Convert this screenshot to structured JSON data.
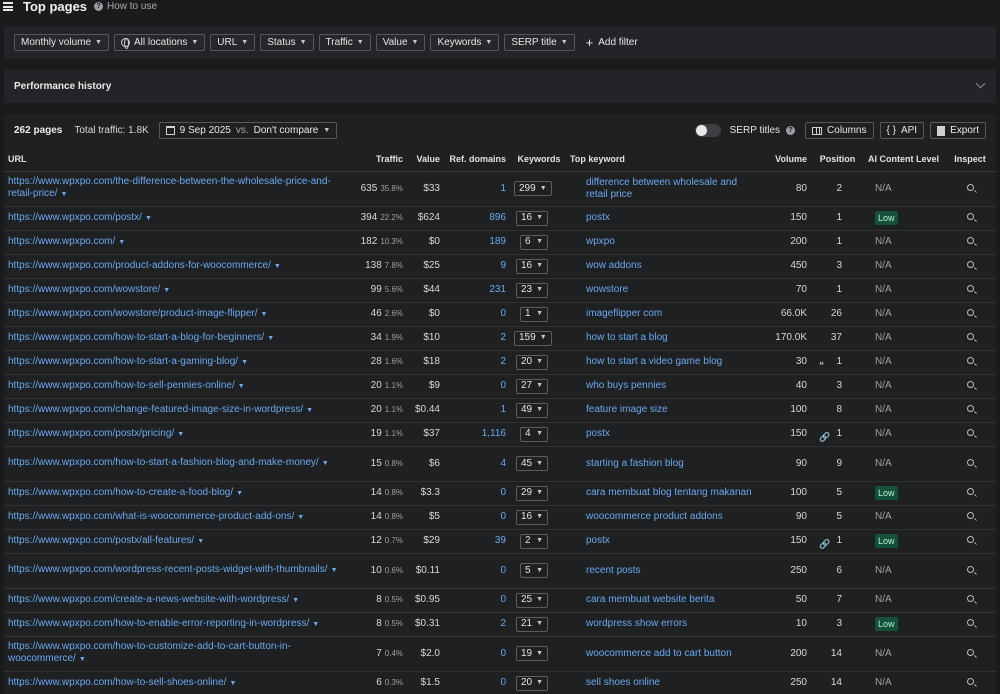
{
  "header": {
    "title": "Top pages",
    "howto": "How to use"
  },
  "filters": [
    {
      "label": "Monthly volume",
      "icon": ""
    },
    {
      "label": "All locations",
      "icon": "globe-icon"
    },
    {
      "label": "URL",
      "icon": ""
    },
    {
      "label": "Status",
      "icon": ""
    },
    {
      "label": "Traffic",
      "icon": ""
    },
    {
      "label": "Value",
      "icon": ""
    },
    {
      "label": "Keywords",
      "icon": ""
    },
    {
      "label": "SERP title",
      "icon": ""
    }
  ],
  "add_filter": "Add filter",
  "performance": {
    "title": "Performance history"
  },
  "toolbar": {
    "pages": "262 pages",
    "total_traffic": "Total traffic: 1.8K",
    "date": "9 Sep 2025",
    "vs": "vs.",
    "compare": "Don't compare",
    "serp_titles": "SERP titles",
    "columns": "Columns",
    "api": "API",
    "export": "Export"
  },
  "columns": [
    "URL",
    "Traffic",
    "Value",
    "Ref. domains",
    "Keywords",
    "Top keyword",
    "Volume",
    "Position",
    "AI Content Level",
    "Inspect"
  ],
  "rows": [
    {
      "url": "https://www.wpxpo.com/the-difference-between-the-wholesale-price-and-retail-price/",
      "traffic": "635",
      "pct": "35.8%",
      "value": "$33",
      "ref": "1",
      "kw": "299",
      "topkw": "difference between wholesale and retail price",
      "volume": "80",
      "pos": "2",
      "pos_icon": "",
      "ai": "N/A",
      "tall": true
    },
    {
      "url": "https://www.wpxpo.com/postx/",
      "traffic": "394",
      "pct": "22.2%",
      "value": "$624",
      "ref": "896",
      "kw": "16",
      "topkw": "postx",
      "volume": "150",
      "pos": "1",
      "pos_icon": "",
      "ai": "Low",
      "tall": false
    },
    {
      "url": "https://www.wpxpo.com/",
      "traffic": "182",
      "pct": "10.3%",
      "value": "$0",
      "ref": "189",
      "kw": "6",
      "topkw": "wpxpo",
      "volume": "200",
      "pos": "1",
      "pos_icon": "",
      "ai": "N/A",
      "tall": false
    },
    {
      "url": "https://www.wpxpo.com/product-addons-for-woocommerce/",
      "traffic": "138",
      "pct": "7.8%",
      "value": "$25",
      "ref": "9",
      "kw": "16",
      "topkw": "wow addons",
      "volume": "450",
      "pos": "3",
      "pos_icon": "",
      "ai": "N/A",
      "tall": false
    },
    {
      "url": "https://www.wpxpo.com/wowstore/",
      "traffic": "99",
      "pct": "5.6%",
      "value": "$44",
      "ref": "231",
      "kw": "23",
      "topkw": "wowstore",
      "volume": "70",
      "pos": "1",
      "pos_icon": "",
      "ai": "N/A",
      "tall": false
    },
    {
      "url": "https://www.wpxpo.com/wowstore/product-image-flipper/",
      "traffic": "46",
      "pct": "2.6%",
      "value": "$0",
      "ref": "0",
      "kw": "1",
      "topkw": "imageflipper com",
      "volume": "66.0K",
      "pos": "26",
      "pos_icon": "",
      "ai": "N/A",
      "tall": false
    },
    {
      "url": "https://www.wpxpo.com/how-to-start-a-blog-for-beginners/",
      "traffic": "34",
      "pct": "1.9%",
      "value": "$10",
      "ref": "2",
      "kw": "159",
      "topkw": "how to start a blog",
      "volume": "170.0K",
      "pos": "37",
      "pos_icon": "",
      "ai": "N/A",
      "tall": false
    },
    {
      "url": "https://www.wpxpo.com/how-to-start-a-gaming-blog/",
      "traffic": "28",
      "pct": "1.6%",
      "value": "$18",
      "ref": "2",
      "kw": "20",
      "topkw": "how to start a video game blog",
      "volume": "30",
      "pos": "1",
      "pos_icon": "❝",
      "ai": "N/A",
      "tall": false
    },
    {
      "url": "https://www.wpxpo.com/how-to-sell-pennies-online/",
      "traffic": "20",
      "pct": "1.1%",
      "value": "$9",
      "ref": "0",
      "kw": "27",
      "topkw": "who buys pennies",
      "volume": "40",
      "pos": "3",
      "pos_icon": "",
      "ai": "N/A",
      "tall": false
    },
    {
      "url": "https://www.wpxpo.com/change-featured-image-size-in-wordpress/",
      "traffic": "20",
      "pct": "1.1%",
      "value": "$0.44",
      "ref": "1",
      "kw": "49",
      "topkw": "feature image size",
      "volume": "100",
      "pos": "8",
      "pos_icon": "",
      "ai": "N/A",
      "tall": false
    },
    {
      "url": "https://www.wpxpo.com/postx/pricing/",
      "traffic": "19",
      "pct": "1.1%",
      "value": "$37",
      "ref": "1,116",
      "kw": "4",
      "topkw": "postx",
      "volume": "150",
      "pos": "1",
      "pos_icon": "🔗",
      "ai": "N/A",
      "tall": false
    },
    {
      "url": "https://www.wpxpo.com/how-to-start-a-fashion-blog-and-make-money/",
      "traffic": "15",
      "pct": "0.8%",
      "value": "$6",
      "ref": "4",
      "kw": "45",
      "topkw": "starting a fashion blog",
      "volume": "90",
      "pos": "9",
      "pos_icon": "",
      "ai": "N/A",
      "tall": true
    },
    {
      "url": "https://www.wpxpo.com/how-to-create-a-food-blog/",
      "traffic": "14",
      "pct": "0.8%",
      "value": "$3.3",
      "ref": "0",
      "kw": "29",
      "topkw": "cara membuat blog tentang makanan",
      "volume": "100",
      "pos": "5",
      "pos_icon": "",
      "ai": "Low",
      "tall": false
    },
    {
      "url": "https://www.wpxpo.com/what-is-woocommerce-product-add-ons/",
      "traffic": "14",
      "pct": "0.8%",
      "value": "$5",
      "ref": "0",
      "kw": "16",
      "topkw": "woocommerce product addons",
      "volume": "90",
      "pos": "5",
      "pos_icon": "",
      "ai": "N/A",
      "tall": false
    },
    {
      "url": "https://www.wpxpo.com/postx/all-features/",
      "traffic": "12",
      "pct": "0.7%",
      "value": "$29",
      "ref": "39",
      "kw": "2",
      "topkw": "postx",
      "volume": "150",
      "pos": "1",
      "pos_icon": "🔗",
      "ai": "Low",
      "tall": false
    },
    {
      "url": "https://www.wpxpo.com/wordpress-recent-posts-widget-with-thumbnails/",
      "traffic": "10",
      "pct": "0.6%",
      "value": "$0.11",
      "ref": "0",
      "kw": "5",
      "topkw": "recent posts",
      "volume": "250",
      "pos": "6",
      "pos_icon": "",
      "ai": "N/A",
      "tall": true
    },
    {
      "url": "https://www.wpxpo.com/create-a-news-website-with-wordpress/",
      "traffic": "8",
      "pct": "0.5%",
      "value": "$0.95",
      "ref": "0",
      "kw": "25",
      "topkw": "cara membuat website berita",
      "volume": "50",
      "pos": "7",
      "pos_icon": "",
      "ai": "N/A",
      "tall": false
    },
    {
      "url": "https://www.wpxpo.com/how-to-enable-error-reporting-in-wordpress/",
      "traffic": "8",
      "pct": "0.5%",
      "value": "$0.31",
      "ref": "2",
      "kw": "21",
      "topkw": "wordpress show errors",
      "volume": "10",
      "pos": "3",
      "pos_icon": "",
      "ai": "Low",
      "tall": false
    },
    {
      "url": "https://www.wpxpo.com/how-to-customize-add-to-cart-button-in-woocommerce/",
      "traffic": "7",
      "pct": "0.4%",
      "value": "$2.0",
      "ref": "0",
      "kw": "19",
      "topkw": "woocommerce add to cart button",
      "volume": "200",
      "pos": "14",
      "pos_icon": "",
      "ai": "N/A",
      "tall": true
    },
    {
      "url": "https://www.wpxpo.com/how-to-sell-shoes-online/",
      "traffic": "6",
      "pct": "0.3%",
      "value": "$1.5",
      "ref": "0",
      "kw": "20",
      "topkw": "sell shoes online",
      "volume": "250",
      "pos": "14",
      "pos_icon": "",
      "ai": "N/A",
      "tall": false
    }
  ]
}
